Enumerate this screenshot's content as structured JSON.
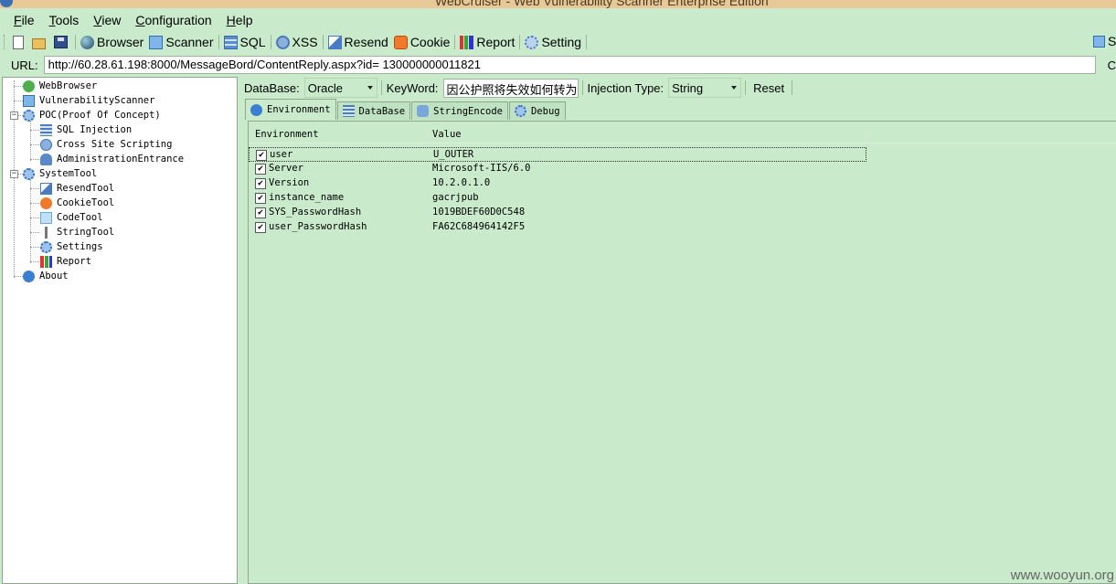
{
  "window": {
    "title": "WebCruiser - Web Vulnerability Scanner Enterprise Edition"
  },
  "menu": [
    {
      "label": "File",
      "accel": "F",
      "rest": "ile"
    },
    {
      "label": "Tools",
      "accel": "T",
      "rest": "ools"
    },
    {
      "label": "View",
      "accel": "V",
      "rest": "iew"
    },
    {
      "label": "Configuration",
      "accel": "C",
      "rest": "onfiguration"
    },
    {
      "label": "Help",
      "accel": "H",
      "rest": "elp"
    }
  ],
  "toolbar": {
    "browser": "Browser",
    "scanner": "Scanner",
    "sql": "SQL",
    "xss": "XSS",
    "resend": "Resend",
    "cookie": "Cookie",
    "report": "Report",
    "setting": "Setting",
    "clipped_right": "S"
  },
  "url_bar": {
    "label": "URL:",
    "value": "http://60.28.61.198:8000/MessageBord/ContentReply.aspx?id= 130000000011821",
    "clipped_right": "C"
  },
  "tree": {
    "webbrowser": "WebBrowser",
    "vulnscanner": "VulnerabilityScanner",
    "poc": "POC(Proof Of Concept)",
    "sqlinj": "SQL Injection",
    "xss": "Cross Site Scripting",
    "admin": "AdministrationEntrance",
    "systemtool": "SystemTool",
    "resendtool": "ResendTool",
    "cookietool": "CookieTool",
    "codetool": "CodeTool",
    "stringtool": "StringTool",
    "settings": "Settings",
    "report": "Report",
    "about": "About"
  },
  "filters": {
    "database_label": "DataBase:",
    "database_value": "Oracle",
    "keyword_label": "KeyWord:",
    "keyword_value": "因公护照将失效如何转为个",
    "injection_label": "Injection Type:",
    "injection_value": "String",
    "reset": "Reset"
  },
  "tabs": {
    "environment": "Environment",
    "database": "DataBase",
    "stringencode": "StringEncode",
    "debug": "Debug"
  },
  "grid": {
    "col_env": "Environment",
    "col_value": "Value",
    "rows": [
      {
        "name": "user",
        "value": "U_OUTER",
        "checked": true
      },
      {
        "name": "Server",
        "value": "Microsoft-IIS/6.0",
        "checked": true
      },
      {
        "name": "Version",
        "value": "10.2.0.1.0",
        "checked": true
      },
      {
        "name": "instance_name",
        "value": "gacrjpub",
        "checked": true
      },
      {
        "name": "SYS_PasswordHash",
        "value": "1019BDEF60D0C548",
        "checked": true
      },
      {
        "name": "user_PasswordHash",
        "value": "FA62C684964142F5",
        "checked": true
      }
    ]
  },
  "watermark": "www.wooyun.org",
  "colors": {
    "panel_bg": "#c9ebcc",
    "titlebar": "#e8c896"
  }
}
